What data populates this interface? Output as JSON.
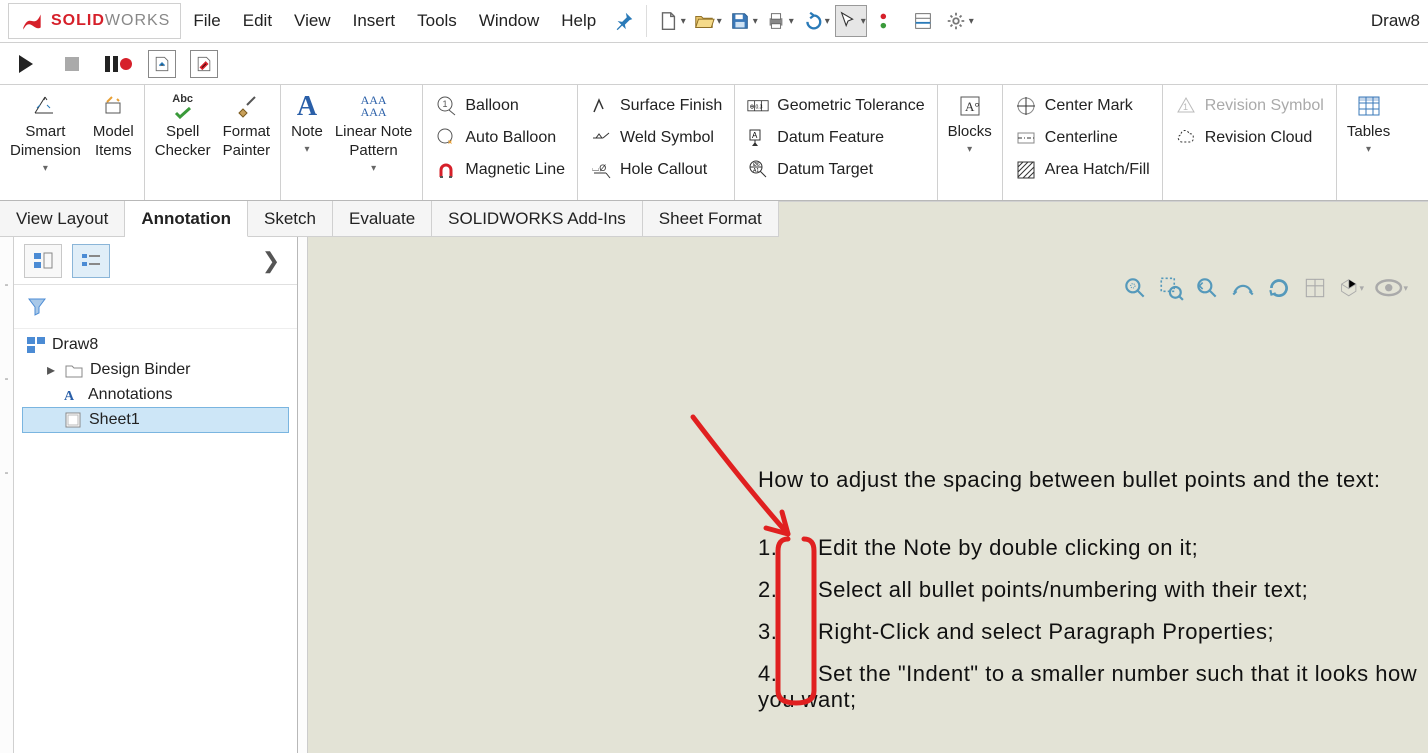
{
  "app": {
    "brand_solid": "SOLID",
    "brand_works": "WORKS",
    "doc_label_right": "Draw8"
  },
  "menu": {
    "file": "File",
    "edit": "Edit",
    "view": "View",
    "insert": "Insert",
    "tools": "Tools",
    "window": "Window",
    "help": "Help"
  },
  "ribbon": {
    "smart_dimension": "Smart\nDimension",
    "model_items": "Model\nItems",
    "spell_checker": "Spell\nChecker",
    "format_painter": "Format\nPainter",
    "note": "Note",
    "linear_note_pattern": "Linear Note\nPattern",
    "balloon": "Balloon",
    "auto_balloon": "Auto Balloon",
    "magnetic_line": "Magnetic Line",
    "surface_finish": "Surface Finish",
    "weld_symbol": "Weld Symbol",
    "hole_callout": "Hole Callout",
    "geometric_tolerance": "Geometric Tolerance",
    "datum_feature": "Datum Feature",
    "datum_target": "Datum Target",
    "blocks": "Blocks",
    "center_mark": "Center Mark",
    "centerline": "Centerline",
    "area_hatch": "Area Hatch/Fill",
    "revision_symbol": "Revision Symbol",
    "revision_cloud": "Revision Cloud",
    "tables": "Tables"
  },
  "tabs": {
    "view_layout": "View Layout",
    "annotation": "Annotation",
    "sketch": "Sketch",
    "evaluate": "Evaluate",
    "addins": "SOLIDWORKS Add-Ins",
    "sheet_format": "Sheet Format"
  },
  "tree": {
    "root": "Draw8",
    "design_binder": "Design Binder",
    "annotations": "Annotations",
    "sheet1": "Sheet1"
  },
  "note": {
    "title": "How to adjust the spacing between bullet points and the text:",
    "items": [
      "Edit the Note by double clicking on it;",
      "Select all bullet points/numbering with their text;",
      "Right-Click and select Paragraph Properties;",
      "Set the \"Indent\" to a smaller number such that it looks how you want;"
    ]
  },
  "numbers": {
    "n1": "1.",
    "n2": "2.",
    "n3": "3.",
    "n4": "4."
  },
  "icons": {
    "pin": "📌",
    "new": "new",
    "open": "open",
    "save": "save",
    "print": "print",
    "undo": "undo",
    "select": "select",
    "rebuild": "rebuild",
    "options": "options",
    "gear": "gear"
  }
}
